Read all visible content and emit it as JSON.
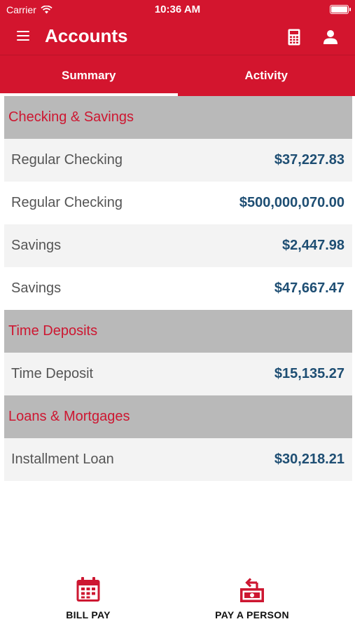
{
  "status_bar": {
    "carrier": "Carrier",
    "time": "10:36 AM"
  },
  "header": {
    "title": "Accounts"
  },
  "tabs": [
    {
      "label": "Summary",
      "active": true
    },
    {
      "label": "Activity",
      "active": false
    }
  ],
  "sections": [
    {
      "title": "Checking & Savings",
      "accounts": [
        {
          "name": "Regular Checking",
          "amount": "$37,227.83"
        },
        {
          "name": "Regular Checking",
          "amount": "$500,000,070.00"
        },
        {
          "name": "Savings",
          "amount": "$2,447.98"
        },
        {
          "name": "Savings",
          "amount": "$47,667.47"
        }
      ]
    },
    {
      "title": "Time Deposits",
      "accounts": [
        {
          "name": "Time Deposit",
          "amount": "$15,135.27"
        }
      ]
    },
    {
      "title": "Loans & Mortgages",
      "accounts": [
        {
          "name": "Installment Loan",
          "amount": "$30,218.21"
        }
      ]
    }
  ],
  "bottom_actions": {
    "bill_pay": "BILL PAY",
    "pay_a_person": "PAY A PERSON"
  },
  "colors": {
    "brand_red": "#d3152e",
    "section_red": "#cd1731",
    "amount_blue": "#1e4e73",
    "section_gray": "#b9b9b9"
  },
  "icons": {
    "menu": "hamburger-menu-icon",
    "calculator": "calculator-icon",
    "user": "user-icon",
    "bill_pay": "calendar-icon",
    "pay_a_person": "money-transfer-icon"
  }
}
